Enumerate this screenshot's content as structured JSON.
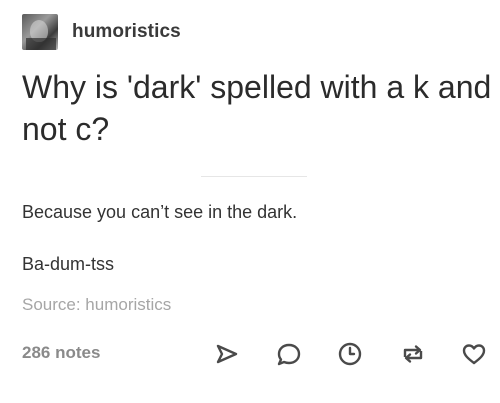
{
  "post": {
    "username": "humoristics",
    "title": "Why is 'dark' spelled with a k and not c?",
    "body": [
      "Because you can’t see in the dark.",
      "Ba-dum-tss"
    ],
    "source": "Source: humoristics",
    "notes": "286 notes"
  },
  "icons": {
    "avatar": "user-avatar",
    "share": "share-arrow-icon",
    "reply": "reply-bubble-icon",
    "queue": "clock-icon",
    "reblog": "reblog-icon",
    "like": "heart-icon"
  },
  "colors": {
    "text": "#2b2b2b",
    "muted": "#a6a6a6",
    "notes": "#8a8a8a",
    "icon": "#4a4a4a"
  }
}
